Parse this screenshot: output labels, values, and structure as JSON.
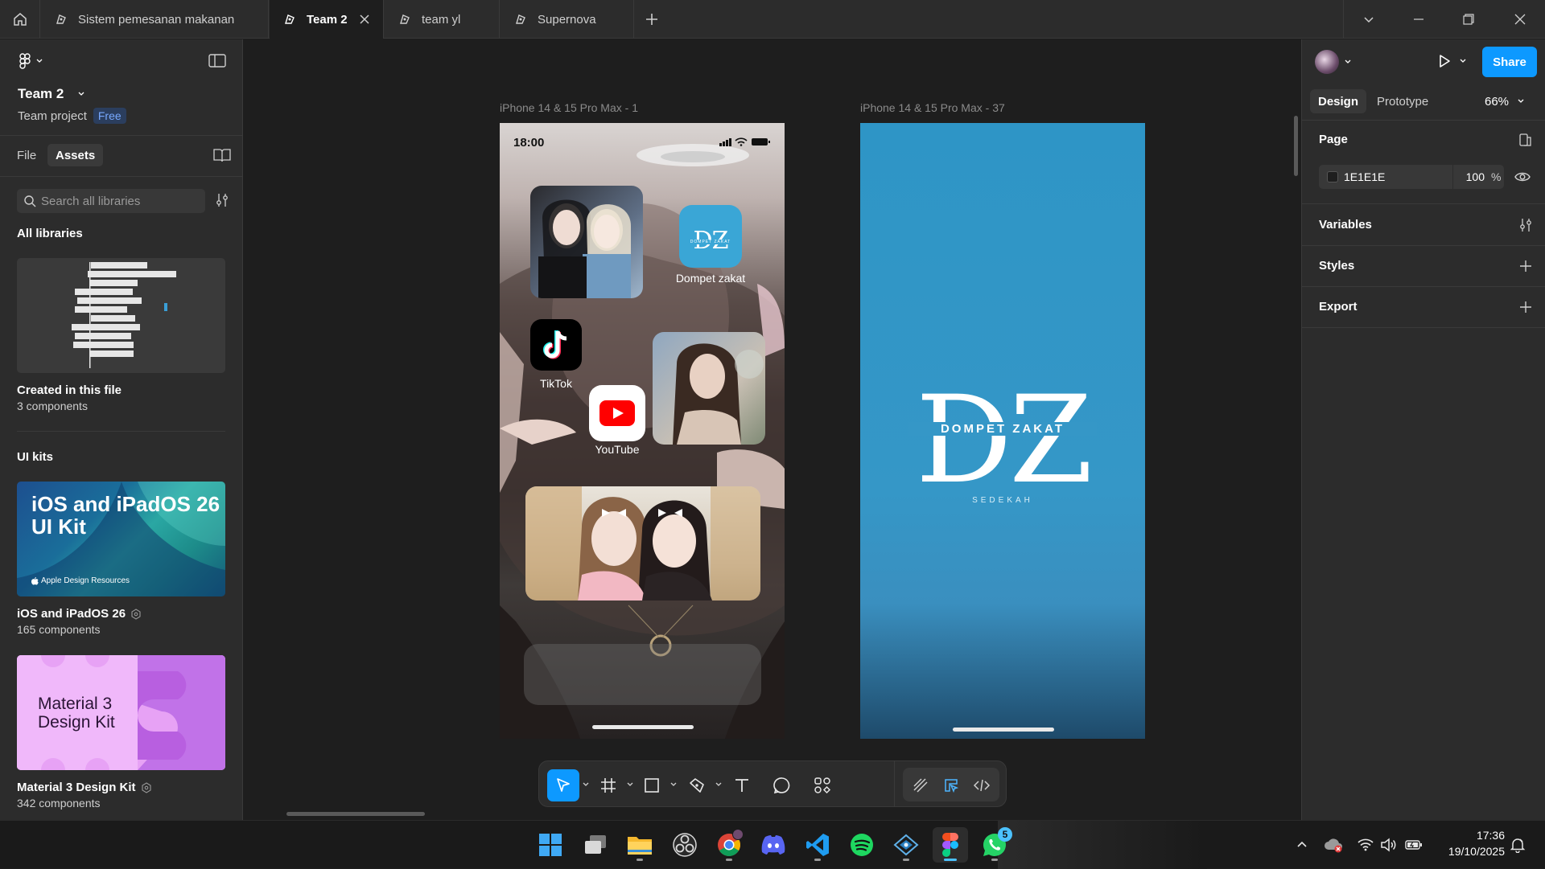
{
  "tabs": [
    {
      "label": "Sistem pemesanan makanan",
      "active": false
    },
    {
      "label": "Team 2",
      "active": true
    },
    {
      "label": "team yl",
      "active": false
    },
    {
      "label": "Supernova",
      "active": false
    }
  ],
  "left_panel": {
    "project_title": "Team 2",
    "project_type": "Team project",
    "plan_badge": "Free",
    "tabs": [
      "File",
      "Assets"
    ],
    "active_tab": "Assets",
    "search_placeholder": "Search all libraries",
    "all_libraries_heading": "All libraries",
    "ui_kits_heading": "UI kits",
    "libraries": [
      {
        "title": "Created in this file",
        "count": "3 components"
      },
      {
        "title": "iOS and iPadOS 26",
        "count": "165 components",
        "thumb_text": "iOS and iPadOS 26\nUI Kit",
        "thumb_caption": "Apple Design Resources"
      },
      {
        "title": "Material 3 Design Kit",
        "count": "342 components",
        "thumb_text": "Material 3\nDesign Kit"
      }
    ]
  },
  "canvas": {
    "frames": [
      {
        "label": "iPhone 14 & 15 Pro Max - 1"
      },
      {
        "label": "iPhone 14 & 15 Pro Max - 37"
      }
    ],
    "frame1": {
      "time": "18:00",
      "apps": [
        {
          "label": "Dompet zakat",
          "icon": "dz-logo-icon"
        },
        {
          "label": "TikTok",
          "icon": "tiktok-icon"
        },
        {
          "label": "YouTube",
          "icon": "youtube-icon"
        }
      ],
      "dz_icon_text": "DZ",
      "dz_icon_subtext": "DOMPET ZAKAT"
    },
    "frame2": {
      "logo_letters": "DZ",
      "logo_title": "DOMPET ZAKAT",
      "logo_subtitle": "SEDEKAH"
    }
  },
  "right_panel": {
    "tabs": [
      "Design",
      "Prototype"
    ],
    "active_tab": "Design",
    "zoom": "66%",
    "share_label": "Share",
    "page_heading": "Page",
    "page_color_hex": "1E1E1E",
    "page_opacity": "100",
    "opacity_unit": "%",
    "sections": [
      "Variables",
      "Styles",
      "Export"
    ]
  },
  "taskbar": {
    "apps": [
      "start-icon",
      "task-view-icon",
      "file-explorer-icon",
      "obs-icon",
      "chrome-icon",
      "discord-icon",
      "vscode-icon",
      "spotify-icon",
      "app-icon",
      "figma-icon",
      "whatsapp-icon"
    ],
    "whatsapp_badge": "5",
    "time": "17:36",
    "date": "19/10/2025"
  },
  "colors": {
    "accent": "#0d99ff",
    "panel": "#2c2c2c",
    "canvas": "#1e1e1e",
    "dz_blue": "#3597c7"
  }
}
